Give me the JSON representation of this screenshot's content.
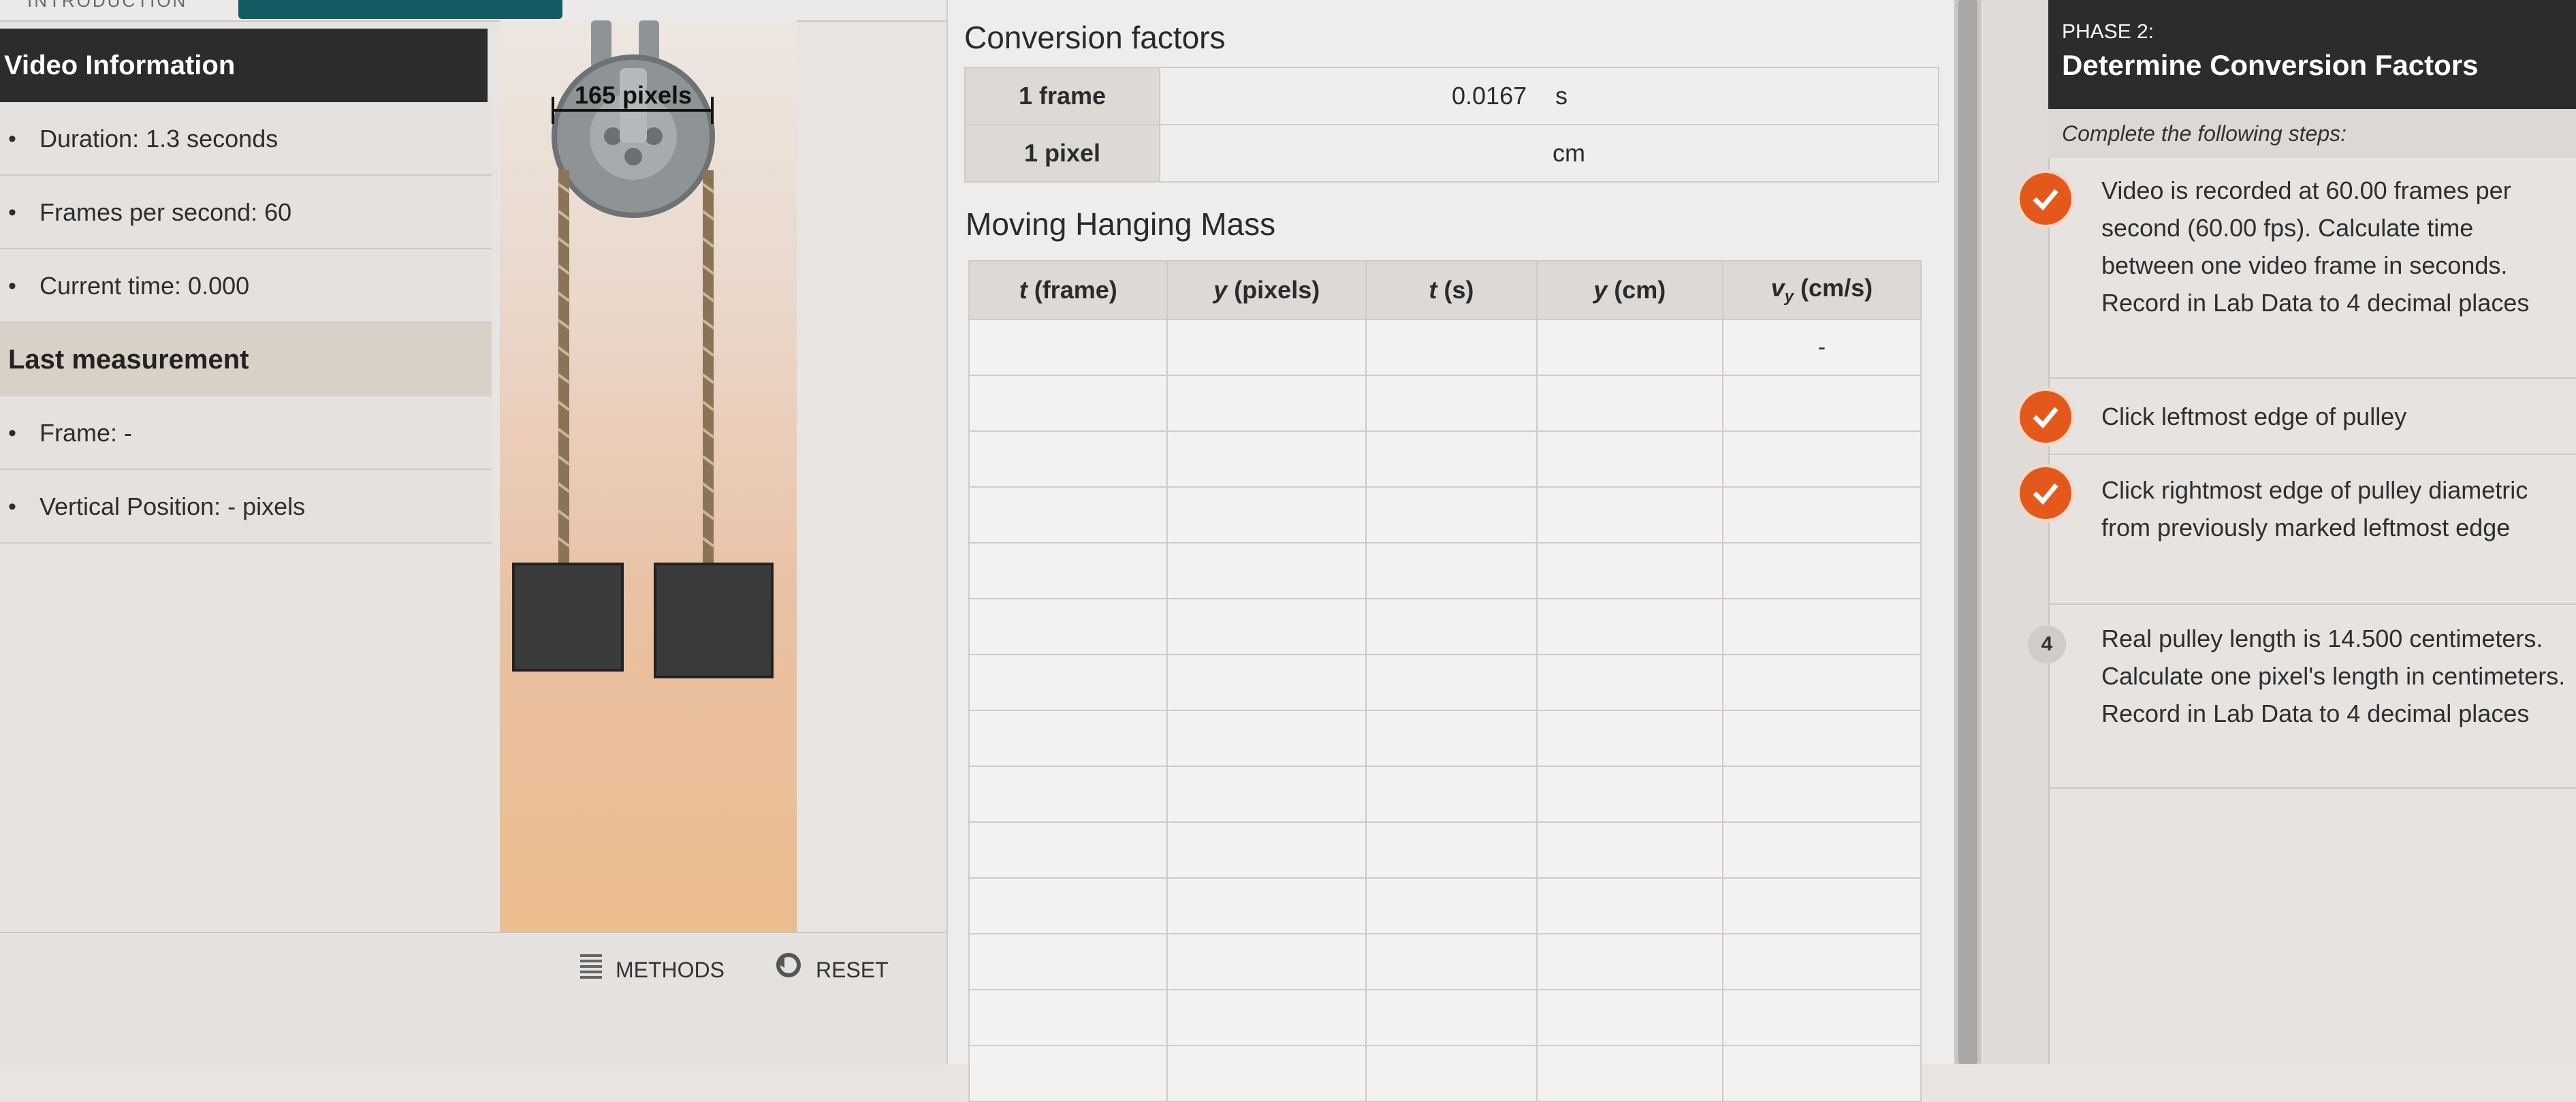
{
  "tabs": {
    "introduction": "INTRODUCTION"
  },
  "video_info": {
    "title": "Video Information",
    "duration": "Duration: 1.3 seconds",
    "fps": "Frames per second: 60",
    "current_time": "Current time: 0.000"
  },
  "last_measurement": {
    "title": "Last measurement",
    "frame": "Frame: -",
    "vertical_position": "Vertical Position: - pixels"
  },
  "video": {
    "pixel_label": "165 pixels"
  },
  "controls": {
    "methods": "METHODS",
    "reset": "RESET"
  },
  "conversion": {
    "title": "Conversion factors",
    "rows": [
      {
        "label": "1 frame",
        "value": "0.0167",
        "unit": "s"
      },
      {
        "label": "1 pixel",
        "value": "",
        "unit": "cm"
      }
    ]
  },
  "motion": {
    "title": "Moving Hanging Mass",
    "headers": [
      "t (frame)",
      "y (pixels)",
      "t (s)",
      "y (cm)",
      "vy (cm/s)"
    ],
    "first_row_vy": "-"
  },
  "phase": {
    "label": "PHASE 2:",
    "title": "Determine Conversion Factors",
    "intro": "Complete the following steps:",
    "steps": [
      {
        "text": "Video is recorded at 60.00 frames per second (60.00 fps). Calculate time between one video frame in seconds. Record in Lab Data to 4 decimal places",
        "done": true
      },
      {
        "text": "Click leftmost edge of pulley",
        "done": true
      },
      {
        "text": "Click rightmost edge of pulley diametric from previously marked leftmost edge",
        "done": true
      },
      {
        "number": "4",
        "text": "Real pulley length is 14.500 centimeters. Calculate one pixel's length in centimeters. Record in Lab Data to 4 decimal places",
        "done": false
      }
    ]
  },
  "colors": {
    "accent": "#e5581c",
    "header_dark": "#2c2c2c",
    "tab_active": "#145b63"
  }
}
